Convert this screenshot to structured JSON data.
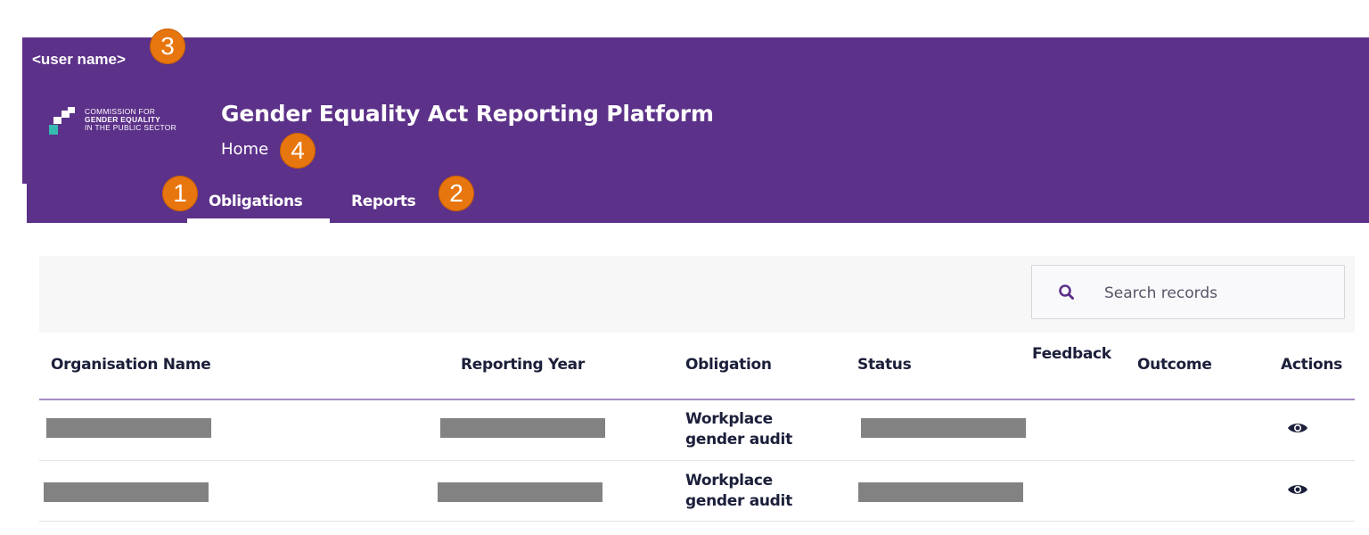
{
  "app": {
    "user_name": "<user name>",
    "title": "Gender Equality Act Reporting Platform",
    "breadcrumb": "Home",
    "logo": {
      "line1": "COMMISSION FOR",
      "line2": "GENDER EQUALITY",
      "line3": "IN THE PUBLIC SECTOR"
    }
  },
  "tabs": [
    {
      "label": "Obligations",
      "active": true
    },
    {
      "label": "Reports",
      "active": false
    }
  ],
  "markers": [
    "1",
    "2",
    "3",
    "4"
  ],
  "search": {
    "placeholder": "Search records"
  },
  "table": {
    "columns": [
      "Organisation Name",
      "Reporting Year",
      "Obligation",
      "Status",
      "Feedback",
      "Outcome",
      "Actions"
    ],
    "rows": [
      {
        "organisation": "[redacted]",
        "reporting_year": "[redacted]",
        "obligation_line1": "Workplace",
        "obligation_line2": "gender audit",
        "status": "[redacted]",
        "feedback": "",
        "outcome": "",
        "action": "view-icon"
      },
      {
        "organisation": "[redacted]",
        "reporting_year": "[redacted]",
        "obligation_line1": "Workplace",
        "obligation_line2": "gender audit",
        "status": "[redacted]",
        "feedback": "",
        "outcome": "",
        "action": "view-icon"
      }
    ]
  },
  "colors": {
    "header_purple": "#5c3189",
    "marker_orange": "#e8760e",
    "logo_teal": "#36b9b0",
    "header_rule": "#a68bc5",
    "text_dark": "#1b1f3a"
  }
}
